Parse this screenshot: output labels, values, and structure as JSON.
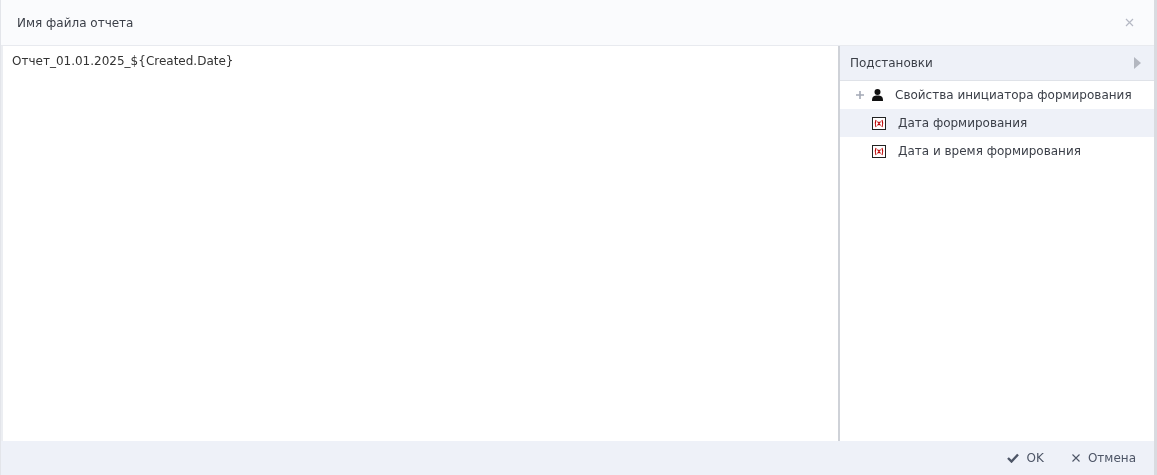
{
  "window": {
    "title": "Имя файла отчета"
  },
  "editor": {
    "value": "Отчет_01.01.2025_${Created.Date}"
  },
  "substitutions": {
    "title": "Подстановки",
    "items": [
      {
        "kind": "object",
        "label": "Свойства инициатора формирования",
        "expanded": false,
        "selected": false
      },
      {
        "kind": "variable",
        "label": "Дата формирования",
        "selected": true
      },
      {
        "kind": "variable",
        "label": "Дата и время формирования",
        "selected": false
      }
    ]
  },
  "buttons": [
    {
      "kind": "ok",
      "label": "OK"
    },
    {
      "kind": "cancel",
      "label": "Отмена"
    }
  ]
}
